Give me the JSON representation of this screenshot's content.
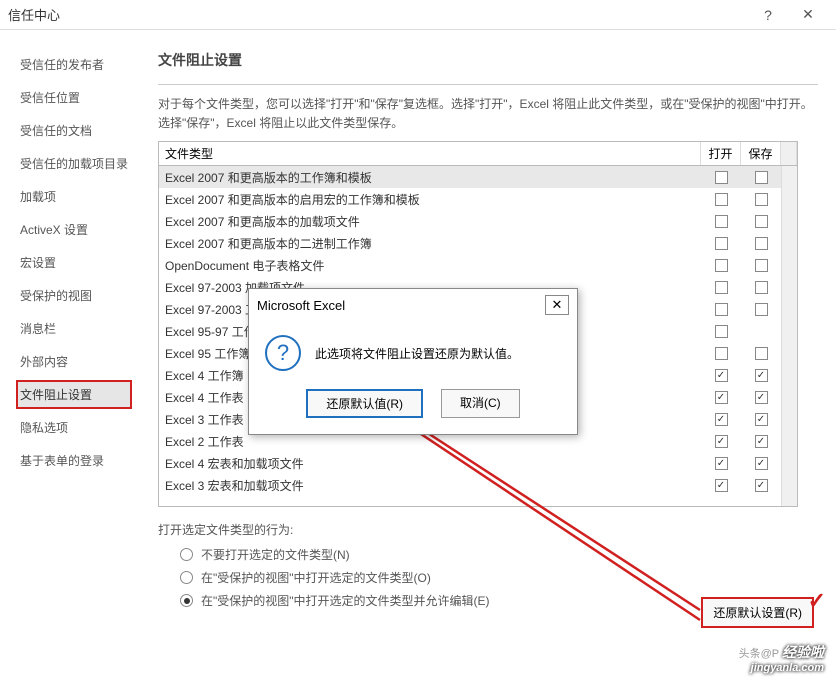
{
  "window": {
    "title": "信任中心"
  },
  "sidebar": {
    "items": [
      {
        "label": "受信任的发布者"
      },
      {
        "label": "受信任位置"
      },
      {
        "label": "受信任的文档"
      },
      {
        "label": "受信任的加载项目录"
      },
      {
        "label": "加载项"
      },
      {
        "label": "ActiveX 设置"
      },
      {
        "label": "宏设置"
      },
      {
        "label": "受保护的视图"
      },
      {
        "label": "消息栏"
      },
      {
        "label": "外部内容"
      },
      {
        "label": "文件阻止设置"
      },
      {
        "label": "隐私选项"
      },
      {
        "label": "基于表单的登录"
      }
    ]
  },
  "panel": {
    "title": "文件阻止设置",
    "desc": "对于每个文件类型，您可以选择\"打开\"和\"保存\"复选框。选择\"打开\"，Excel 将阻止此文件类型，或在\"受保护的视图\"中打开。选择\"保存\"，Excel 将阻止以此文件类型保存。"
  },
  "tableHead": {
    "type": "文件类型",
    "open": "打开",
    "save": "保存"
  },
  "rows": [
    {
      "label": "Excel 2007 和更高版本的工作簿和模板",
      "open": false,
      "save": false,
      "hl": true
    },
    {
      "label": "Excel 2007 和更高版本的启用宏的工作簿和模板",
      "open": false,
      "save": false
    },
    {
      "label": "Excel 2007 和更高版本的加载项文件",
      "open": false,
      "save": false
    },
    {
      "label": "Excel 2007 和更高版本的二进制工作簿",
      "open": false,
      "save": false
    },
    {
      "label": "OpenDocument 电子表格文件",
      "open": false,
      "save": false
    },
    {
      "label": "Excel 97-2003 加载项文件",
      "open": false,
      "save": false
    },
    {
      "label": "Excel 97-2003 工作簿和模板",
      "open": false,
      "save": false
    },
    {
      "label": "Excel 95-97 工作簿和模板",
      "open": false,
      "save": null
    },
    {
      "label": "Excel 95 工作簿",
      "open": false,
      "save": false
    },
    {
      "label": "Excel 4 工作簿",
      "open": true,
      "save": true
    },
    {
      "label": "Excel 4 工作表",
      "open": true,
      "save": true
    },
    {
      "label": "Excel 3 工作表",
      "open": true,
      "save": true
    },
    {
      "label": "Excel 2 工作表",
      "open": true,
      "save": true
    },
    {
      "label": "Excel 4 宏表和加载项文件",
      "open": true,
      "save": true
    },
    {
      "label": "Excel 3 宏表和加载项文件",
      "open": true,
      "save": true
    }
  ],
  "behavior": {
    "title": "打开选定文件类型的行为:",
    "opts": [
      {
        "label": "不要打开选定的文件类型(N)",
        "sel": false
      },
      {
        "label": "在\"受保护的视图\"中打开选定的文件类型(O)",
        "sel": false
      },
      {
        "label": "在\"受保护的视图\"中打开选定的文件类型并允许编辑(E)",
        "sel": true
      }
    ]
  },
  "restoreBtn": "还原默认设置(R)",
  "dialog": {
    "title": "Microsoft Excel",
    "msg": "此选项将文件阻止设置还原为默认值。",
    "ok": "还原默认值(R)",
    "cancel": "取消(C)"
  },
  "watermark": {
    "l1": "头条@P",
    "l2": "经验啦",
    "l3": "jingyanla.com"
  }
}
